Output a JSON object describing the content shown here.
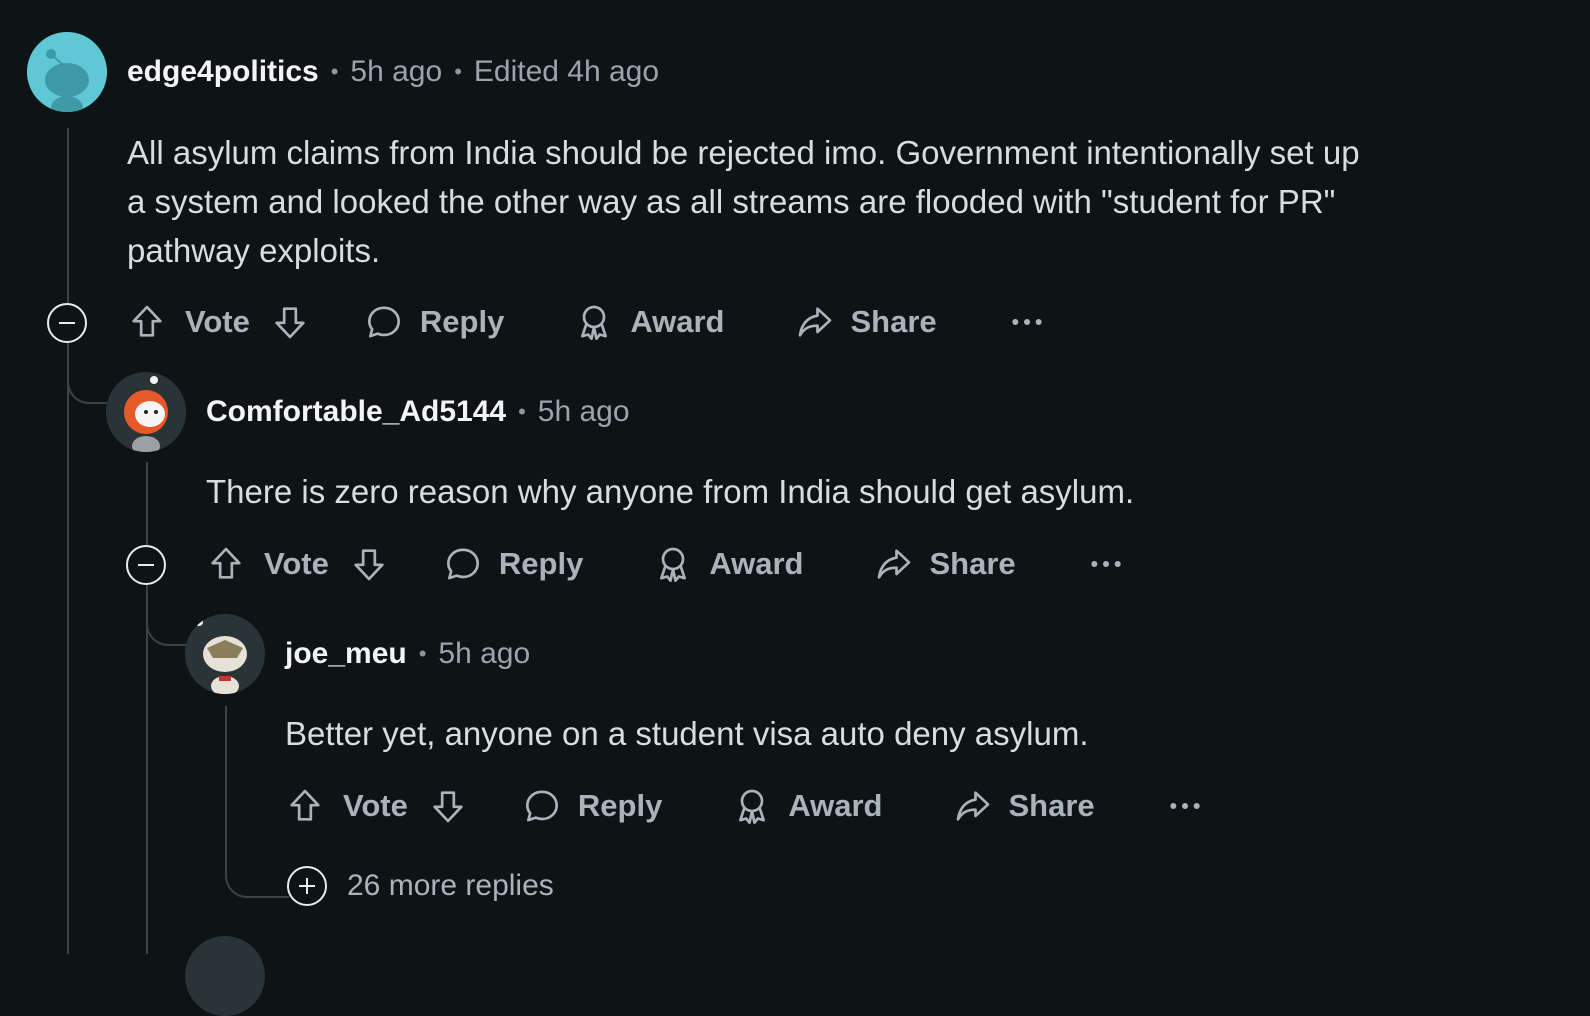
{
  "comments": [
    {
      "username": "edge4politics",
      "time": "5h ago",
      "edited": "Edited 4h ago",
      "body": "All asylum claims from India should be rejected imo. Government intentionally set up a system and looked the other way as all streams are flooded with \"student for PR\" pathway exploits.",
      "actions": {
        "vote": "Vote",
        "reply": "Reply",
        "award": "Award",
        "share": "Share"
      },
      "avatar_color": "#5fc8d4"
    },
    {
      "username": "Comfortable_Ad5144",
      "time": "5h ago",
      "body": "There is zero reason why anyone from India should get asylum.",
      "actions": {
        "vote": "Vote",
        "reply": "Reply",
        "award": "Award",
        "share": "Share"
      },
      "avatar_color": "#e8592a"
    },
    {
      "username": "joe_meu",
      "time": "5h ago",
      "body": "Better yet, anyone on a student visa auto deny asylum.",
      "actions": {
        "vote": "Vote",
        "reply": "Reply",
        "award": "Award",
        "share": "Share"
      },
      "avatar_color": "#d9d4c8"
    }
  ],
  "more_replies": "26 more replies",
  "icons": [
    "upvote-icon",
    "downvote-icon",
    "reply-icon",
    "award-icon",
    "share-icon",
    "more-options-icon",
    "collapse-icon",
    "expand-icon"
  ],
  "colors": {
    "background": "#0e1416",
    "text": "#d7dde0",
    "muted": "#aab4b8",
    "thread_line": "#3a4447"
  }
}
